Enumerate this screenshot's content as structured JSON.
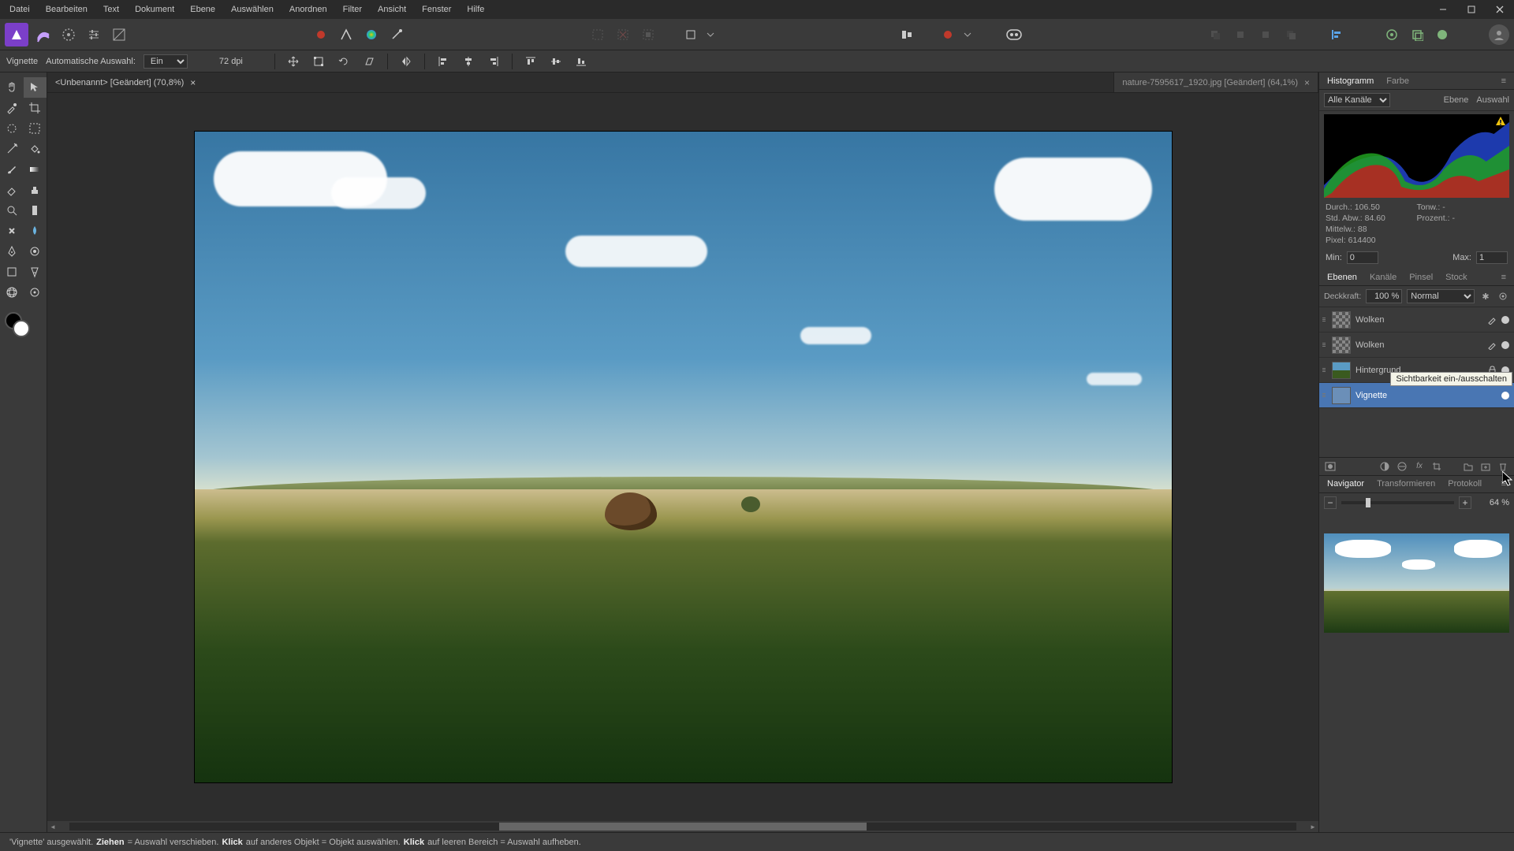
{
  "menubar": [
    "Datei",
    "Bearbeiten",
    "Text",
    "Dokument",
    "Ebene",
    "Auswählen",
    "Anordnen",
    "Filter",
    "Ansicht",
    "Fenster",
    "Hilfe"
  ],
  "context": {
    "tool_label": "Vignette",
    "auto_select_label": "Automatische Auswahl:",
    "auto_select_value": "Ein",
    "dpi": "72 dpi"
  },
  "tabs": [
    {
      "title": "<Unbenannt> [Geändert] (70,8%)",
      "active": true
    },
    {
      "title": "nature-7595617_1920.jpg [Geändert] (64,1%)",
      "active": false
    }
  ],
  "right": {
    "histogram_tab": "Histogramm",
    "color_tab": "Farbe",
    "channel_label": "Alle Kanäle",
    "layer_btn": "Ebene",
    "select_btn": "Auswahl",
    "stats": {
      "mean_k": "Durch.:",
      "mean_v": "106.50",
      "stddev_k": "Std. Abw.:",
      "stddev_v": "84.60",
      "median_k": "Mittelw.:",
      "median_v": "88",
      "pixels_k": "Pixel:",
      "pixels_v": "614400",
      "tone_k": "Tonw.:",
      "tone_v": "-",
      "pct_k": "Prozent.:",
      "pct_v": "-"
    },
    "min_label": "Min:",
    "min_val": "0",
    "max_label": "Max:",
    "max_val": "1"
  },
  "layers_panel": {
    "tab_layers": "Ebenen",
    "tab_channels": "Kanäle",
    "tab_brush": "Pinsel",
    "tab_stock": "Stock",
    "opacity_label": "Deckkraft:",
    "opacity_val": "100 %",
    "blend_mode": "Normal",
    "layers": [
      {
        "name": "Wolken",
        "thumb": "checker",
        "pencil": true,
        "lock": false
      },
      {
        "name": "Wolken",
        "thumb": "checker",
        "pencil": true,
        "lock": false
      },
      {
        "name": "Hintergrund",
        "thumb": "image",
        "pencil": false,
        "lock": true
      },
      {
        "name": "Vignette",
        "thumb": "solid",
        "pencil": false,
        "lock": false,
        "selected": true
      }
    ],
    "tooltip": "Sichtbarkeit ein-/ausschalten"
  },
  "navigator": {
    "tab_nav": "Navigator",
    "tab_transform": "Transformieren",
    "tab_history": "Protokoll",
    "zoom": "64 %"
  },
  "status": {
    "p1": "'Vignette' ausgewählt. ",
    "b1": "Ziehen",
    "p2": " = Auswahl verschieben. ",
    "b2": "Klick",
    "p3": " auf anderes Objekt = Objekt auswählen. ",
    "b3": "Klick",
    "p4": " auf leeren Bereich = Auswahl aufheben."
  }
}
